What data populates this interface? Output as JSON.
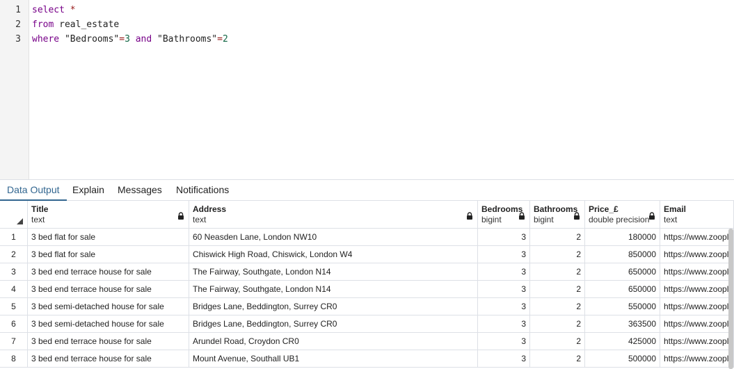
{
  "editor": {
    "line_numbers": [
      "1",
      "2",
      "3"
    ],
    "lines": [
      [
        {
          "t": "select",
          "c": "kw"
        },
        {
          "t": " *",
          "c": "op"
        }
      ],
      [
        {
          "t": "from",
          "c": "kw"
        },
        {
          "t": " real_estate",
          "c": ""
        }
      ],
      [
        {
          "t": "where",
          "c": "kw"
        },
        {
          "t": " \"Bedrooms\"",
          "c": "str"
        },
        {
          "t": "=",
          "c": "op"
        },
        {
          "t": "3",
          "c": "num"
        },
        {
          "t": " ",
          "c": ""
        },
        {
          "t": "and",
          "c": "kw"
        },
        {
          "t": " \"Bathrooms\"",
          "c": "str"
        },
        {
          "t": "=",
          "c": "op"
        },
        {
          "t": "2",
          "c": "num"
        }
      ]
    ]
  },
  "tabs": [
    {
      "label": "Data Output",
      "active": true
    },
    {
      "label": "Explain",
      "active": false
    },
    {
      "label": "Messages",
      "active": false
    },
    {
      "label": "Notifications",
      "active": false
    }
  ],
  "grid": {
    "columns": [
      {
        "name": "Title",
        "type": "text",
        "locked": true
      },
      {
        "name": "Address",
        "type": "text",
        "locked": true
      },
      {
        "name": "Bedrooms",
        "type": "bigint",
        "locked": true
      },
      {
        "name": "Bathrooms",
        "type": "bigint",
        "locked": true
      },
      {
        "name": "Price_£",
        "type": "double precision",
        "locked": true
      },
      {
        "name": "Email",
        "type": "text",
        "locked": false
      }
    ],
    "rows": [
      {
        "n": "1",
        "title": "3 bed flat for sale",
        "address": "60 Neasden Lane, London NW10",
        "bedrooms": "3",
        "bathrooms": "2",
        "price": "180000",
        "email": "https://www.zoopla.co.uk"
      },
      {
        "n": "2",
        "title": "3 bed flat for sale",
        "address": "Chiswick High Road, Chiswick, London W4",
        "bedrooms": "3",
        "bathrooms": "2",
        "price": "850000",
        "email": "https://www.zoopla.co.uk"
      },
      {
        "n": "3",
        "title": "3 bed end terrace house for sale",
        "address": "The Fairway, Southgate, London N14",
        "bedrooms": "3",
        "bathrooms": "2",
        "price": "650000",
        "email": "https://www.zoopla.co.uk"
      },
      {
        "n": "4",
        "title": "3 bed end terrace house for sale",
        "address": "The Fairway, Southgate, London N14",
        "bedrooms": "3",
        "bathrooms": "2",
        "price": "650000",
        "email": "https://www.zoopla.co.uk"
      },
      {
        "n": "5",
        "title": "3 bed semi-detached house for sale",
        "address": "Bridges Lane, Beddington, Surrey CR0",
        "bedrooms": "3",
        "bathrooms": "2",
        "price": "550000",
        "email": "https://www.zoopla.co.uk"
      },
      {
        "n": "6",
        "title": "3 bed semi-detached house for sale",
        "address": "Bridges Lane, Beddington, Surrey CR0",
        "bedrooms": "3",
        "bathrooms": "2",
        "price": "363500",
        "email": "https://www.zoopla.co.uk"
      },
      {
        "n": "7",
        "title": "3 bed end terrace house for sale",
        "address": "Arundel Road, Croydon CR0",
        "bedrooms": "3",
        "bathrooms": "2",
        "price": "425000",
        "email": "https://www.zoopla.co.uk"
      },
      {
        "n": "8",
        "title": "3 bed end terrace house for sale",
        "address": "Mount Avenue, Southall UB1",
        "bedrooms": "3",
        "bathrooms": "2",
        "price": "500000",
        "email": "https://www.zoopla.co.uk"
      }
    ]
  },
  "icons": {
    "lock": "lock-icon",
    "sort": "sort-triangle-icon"
  },
  "colors": {
    "keyword": "#770088",
    "number": "#116644",
    "accent": "#326690"
  }
}
